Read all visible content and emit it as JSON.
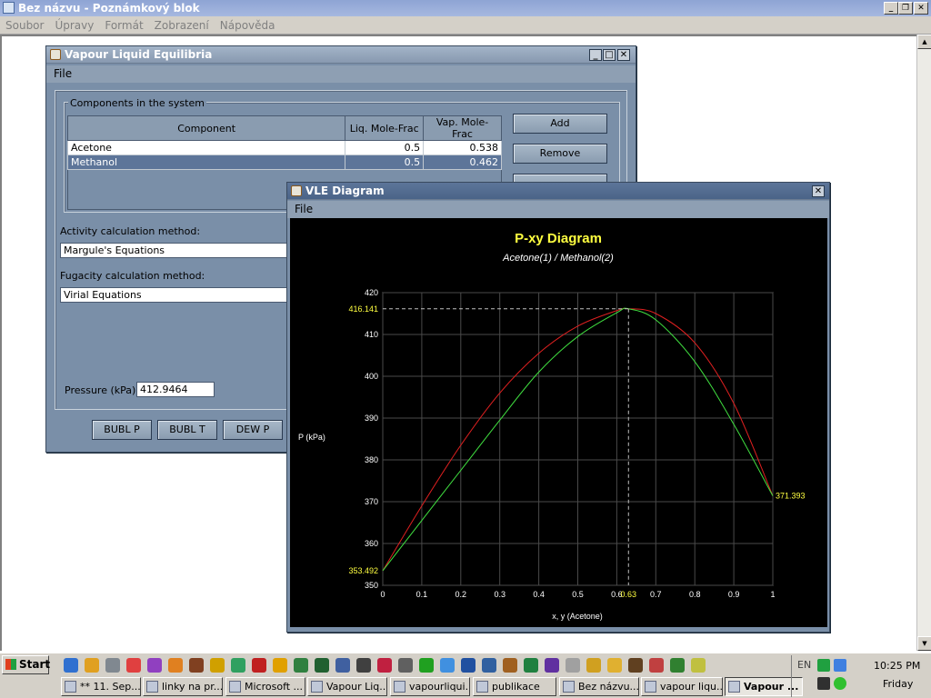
{
  "notepad": {
    "title": "Bez názvu - Poznámkový blok",
    "menu": [
      "Soubor",
      "Úpravy",
      "Formát",
      "Zobrazení",
      "Nápověda"
    ]
  },
  "vle_main": {
    "title": "Vapour Liquid Equilibria",
    "menu": [
      "File"
    ],
    "group_title": "Components in the system",
    "table": {
      "headers": [
        "Component",
        "Liq. Mole-Frac",
        "Vap. Mole-Frac"
      ],
      "rows": [
        {
          "component": "Acetone",
          "liq": "0.5",
          "vap": "0.538"
        },
        {
          "component": "Methanol",
          "liq": "0.5",
          "vap": "0.462"
        }
      ]
    },
    "buttons": {
      "add": "Add",
      "remove": "Remove"
    },
    "activity_label": "Activity calculation method:",
    "activity_value": "Margule's Equations",
    "fugacity_label": "Fugacity calculation method:",
    "fugacity_value": "Virial Equations",
    "pressure_label": "Pressure (kPa):",
    "pressure_value": "412.9464",
    "calc_buttons": [
      "BUBL P",
      "BUBL T",
      "DEW P"
    ]
  },
  "vle_diagram": {
    "title": "VLE Diagram",
    "menu": [
      "File"
    ]
  },
  "chart_data": {
    "type": "line",
    "title": "P-xy Diagram",
    "subtitle": "Acetone(1) / Methanol(2)",
    "xlabel": "x, y (Acetone)",
    "ylabel": "P (kPa)",
    "xlim": [
      0,
      1
    ],
    "ylim": [
      350,
      420
    ],
    "xticks": [
      "0",
      "0.1",
      "0.2",
      "0.3",
      "0.4",
      "0.5",
      "0.6",
      "0.7",
      "0.8",
      "0.9",
      "1"
    ],
    "yticks": [
      "350",
      "360",
      "370",
      "380",
      "390",
      "400",
      "410",
      "420"
    ],
    "grid": true,
    "series": [
      {
        "color": "#e02020",
        "x": [
          0,
          0.1,
          0.2,
          0.3,
          0.4,
          0.5,
          0.6,
          0.63,
          0.7,
          0.8,
          0.9,
          1
        ],
        "values": [
          353.492,
          369.0,
          383.5,
          396.0,
          405.5,
          412.0,
          415.7,
          416.141,
          415.0,
          408.0,
          393.5,
          371.393
        ]
      },
      {
        "color": "#40e040",
        "x": [
          0,
          0.1,
          0.2,
          0.3,
          0.4,
          0.5,
          0.6,
          0.63,
          0.7,
          0.8,
          0.9,
          1
        ],
        "values": [
          353.492,
          365.5,
          377.5,
          389.5,
          401.0,
          409.5,
          415.2,
          416.141,
          413.5,
          403.5,
          388.5,
          371.393
        ]
      }
    ],
    "annotations": {
      "azeotrope_x": "0.63",
      "azeotrope_p": "416.141",
      "p_at_x0": "353.492",
      "p_at_x1": "371.393"
    },
    "colors": {
      "title": "#ffff40",
      "annotation": "#ffff40",
      "background": "#000000"
    }
  },
  "taskbar": {
    "start": "Start",
    "tasks": [
      "** 11. Sep...",
      "linky na pr...",
      "Microsoft ...",
      "Vapour Liq...",
      "vapourliqui...",
      "publikace",
      "Bez názvu...",
      "vapour liqu...",
      "Vapour ..."
    ],
    "lang": "EN",
    "time": "10:25 PM",
    "day": "Friday"
  }
}
